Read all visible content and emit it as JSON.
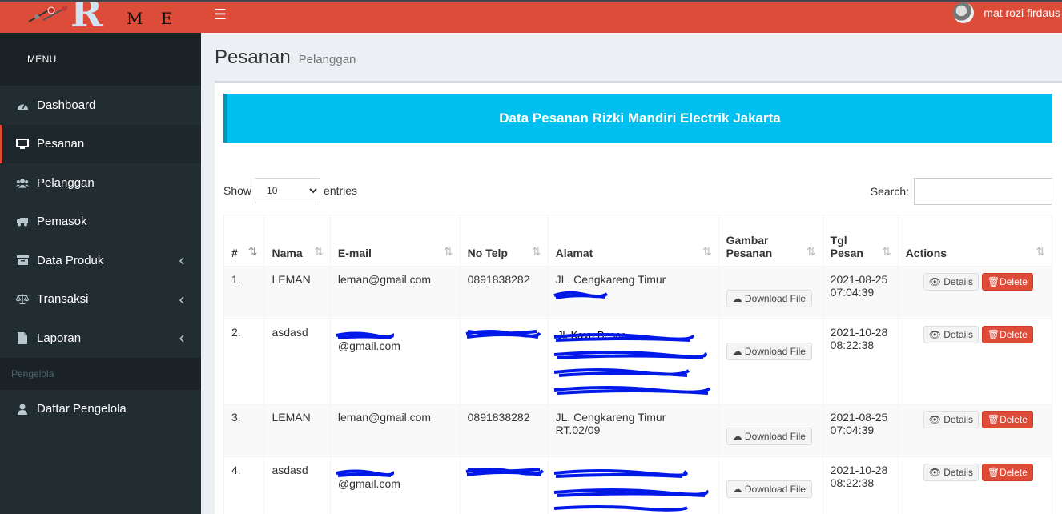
{
  "app": {
    "logo_text": "R",
    "logo_suffix": "M E"
  },
  "header": {
    "toggle_icon": "hamburger-icon",
    "user_name": "mat rozi firdaus"
  },
  "sidebar": {
    "menu_label": "MENU",
    "items": [
      {
        "label": "Dashboard",
        "icon": "dashboard-icon"
      },
      {
        "label": "Pesanan",
        "icon": "desktop-icon",
        "active": true
      },
      {
        "label": "Pelanggan",
        "icon": "users-icon"
      },
      {
        "label": "Pemasok",
        "icon": "truck-icon"
      },
      {
        "label": "Data Produk",
        "icon": "archive-icon",
        "expandable": true
      },
      {
        "label": "Transaksi",
        "icon": "balance-scale-icon",
        "expandable": true
      },
      {
        "label": "Laporan",
        "icon": "file-icon",
        "expandable": true
      }
    ],
    "section_label": "Pengelola",
    "section_items": [
      {
        "label": "Daftar Pengelola",
        "icon": "user-icon"
      }
    ]
  },
  "page": {
    "title": "Pesanan",
    "subtitle": "Pelanggan"
  },
  "banner": {
    "text": "Data Pesanan Rizki Mandiri Electrik Jakarta"
  },
  "table_controls": {
    "show_label": "Show",
    "entries_value": "10",
    "entries_label": "entries",
    "search_label": "Search:"
  },
  "table": {
    "columns": [
      "#",
      "Nama",
      "E-mail",
      "No Telp",
      "Alamat",
      "Gambar Pesanan",
      "Tgl Pesan",
      "Actions"
    ],
    "rows": [
      {
        "no": "1.",
        "nama": "LEMAN",
        "email": "leman@gmail.com",
        "telp": "0891838282",
        "alamat1": "JL. Cengkareng Timur",
        "alamat2": "",
        "tgl1": "2021-08-25",
        "tgl2": "07:04:39"
      },
      {
        "no": "2.",
        "nama": "asdasd",
        "email": "@gmail.com",
        "telp": "",
        "alamat1": "",
        "alamat2": "",
        "tgl1": "2021-10-28",
        "tgl2": "08:22:38"
      },
      {
        "no": "3.",
        "nama": "LEMAN",
        "email": "leman@gmail.com",
        "telp": "0891838282",
        "alamat1": "JL. Cengkareng Timur",
        "alamat2": "RT.02/09",
        "tgl1": "2021-08-25",
        "tgl2": "07:04:39"
      },
      {
        "no": "4.",
        "nama": "asdasd",
        "email": "@gmail.com",
        "telp": "",
        "alamat1": "",
        "alamat2": "",
        "tgl1": "2021-10-28",
        "tgl2": "08:22:38"
      }
    ],
    "download_label": "Download File",
    "details_label": "Details",
    "delete_label": "Delete"
  },
  "colors": {
    "header_red": "#dd4b39",
    "sidebar_dark": "#222d32",
    "banner_cyan": "#00c0ef",
    "delete_red": "#dd4b39"
  }
}
